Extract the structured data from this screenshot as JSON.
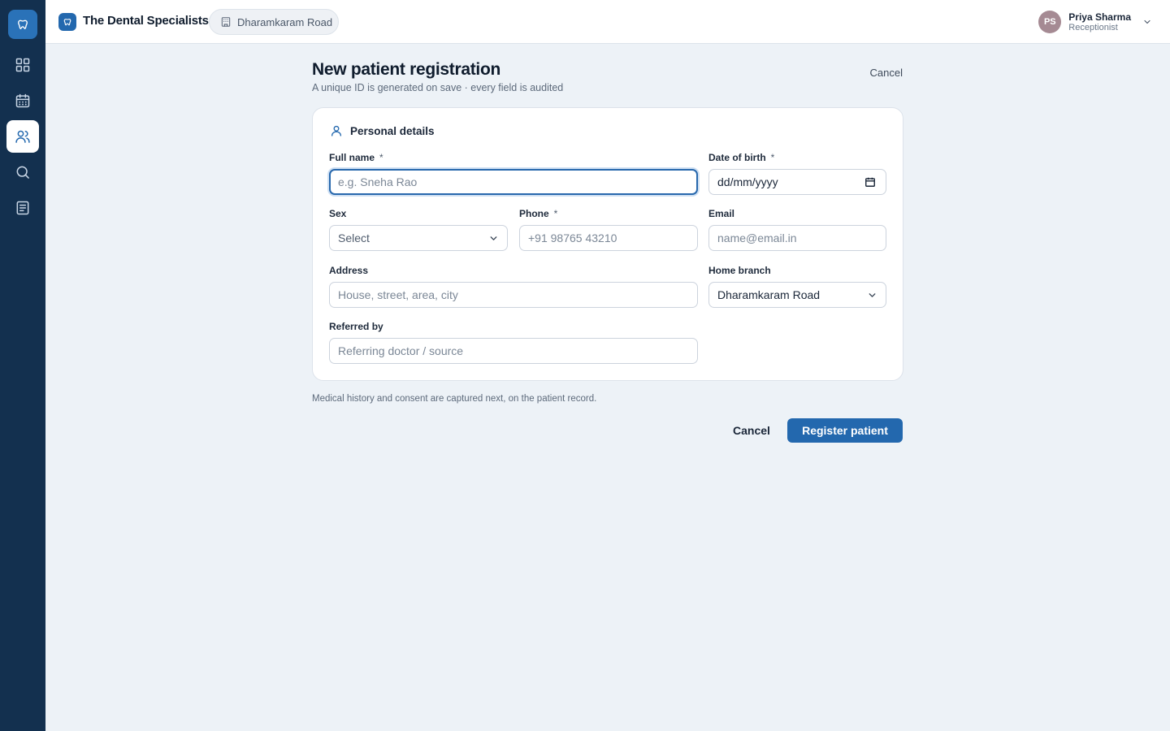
{
  "app": {
    "name": "The Dental Specialists",
    "branch": "Dharamkaram Road"
  },
  "user": {
    "initials": "PS",
    "name": "Priya Sharma",
    "role": "Receptionist"
  },
  "sidebar": {
    "items": [
      {
        "icon": "dashboard-grid-icon",
        "active": false
      },
      {
        "icon": "calendar-icon",
        "active": false
      },
      {
        "icon": "patients-icon",
        "active": true
      },
      {
        "icon": "search-icon",
        "active": false
      },
      {
        "icon": "document-icon",
        "active": false
      }
    ]
  },
  "page": {
    "title": "New patient registration",
    "subtitle": "A unique ID is generated on save · every field is audited",
    "cancel_label": "Cancel"
  },
  "form": {
    "section_title": "Personal details",
    "full_name": {
      "label": "Full name",
      "required_mark": "*",
      "placeholder": "e.g. Sneha Rao"
    },
    "dob": {
      "label": "Date of birth",
      "required_mark": "*",
      "placeholder": "dd/mm/yyyy"
    },
    "sex": {
      "label": "Sex",
      "value": "Select"
    },
    "phone": {
      "label": "Phone",
      "required_mark": "*",
      "placeholder": "+91 98765 43210"
    },
    "email": {
      "label": "Email",
      "placeholder": "name@email.in"
    },
    "address": {
      "label": "Address",
      "placeholder": "House, street, area, city"
    },
    "home_branch": {
      "label": "Home branch",
      "value": "Dharamkaram Road"
    },
    "referred_by": {
      "label": "Referred by",
      "placeholder": "Referring doctor / source"
    }
  },
  "footer": {
    "note": "Medical history and consent are captured next, on the patient record.",
    "cancel_label": "Cancel",
    "submit_label": "Register patient"
  },
  "colors": {
    "sidebar_bg": "#13304f",
    "accent": "#2368ae",
    "page_bg": "#edf2f7"
  }
}
